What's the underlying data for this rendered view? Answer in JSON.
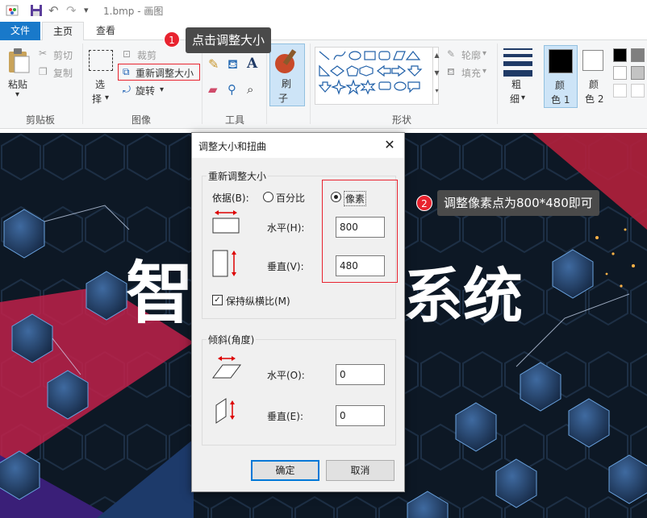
{
  "window": {
    "title": "1.bmp - 画图"
  },
  "tabs": {
    "file": "文件",
    "home": "主页",
    "view": "查看"
  },
  "ribbon": {
    "clipboard": {
      "paste": "粘贴",
      "cut": "剪切",
      "copy": "复制",
      "group": "剪贴板"
    },
    "image": {
      "select_top": "选",
      "select_bottom": "择",
      "crop": "裁剪",
      "resize": "重新调整大小",
      "rotate": "旋转",
      "group": "图像"
    },
    "tools": {
      "group": "工具"
    },
    "brushes": {
      "top": "刷",
      "bottom": "子"
    },
    "shapes": {
      "outline": "轮廓",
      "fill": "填充",
      "group": "形状"
    },
    "size": {
      "top": "粗",
      "bottom": "细"
    },
    "color1": {
      "top": "颜",
      "bottom": "色 1"
    },
    "color2": {
      "top": "颜",
      "bottom": "色 2"
    }
  },
  "colors": {
    "accent": "#1979ca",
    "annotation_red": "#e8232f",
    "dialog_primary": "#0078d7"
  },
  "annotations": {
    "step1": {
      "num": "1",
      "text": "点击调整大小"
    },
    "step2": {
      "num": "2",
      "text": "调整像素点为800*480即可"
    }
  },
  "background_text": {
    "left": "智",
    "right": "系统"
  },
  "dialog": {
    "title": "调整大小和扭曲",
    "resize": {
      "legend": "重新调整大小",
      "basis_label": "依据(B):",
      "percent": "百分比",
      "pixels": "像素",
      "horizontal_label": "水平(H):",
      "horizontal_value": "800",
      "vertical_label": "垂直(V):",
      "vertical_value": "480",
      "keep_ratio": "保持纵横比(M)"
    },
    "skew": {
      "legend": "倾斜(角度)",
      "horizontal_label": "水平(O):",
      "horizontal_value": "0",
      "vertical_label": "垂直(E):",
      "vertical_value": "0"
    },
    "ok": "确定",
    "cancel": "取消"
  }
}
